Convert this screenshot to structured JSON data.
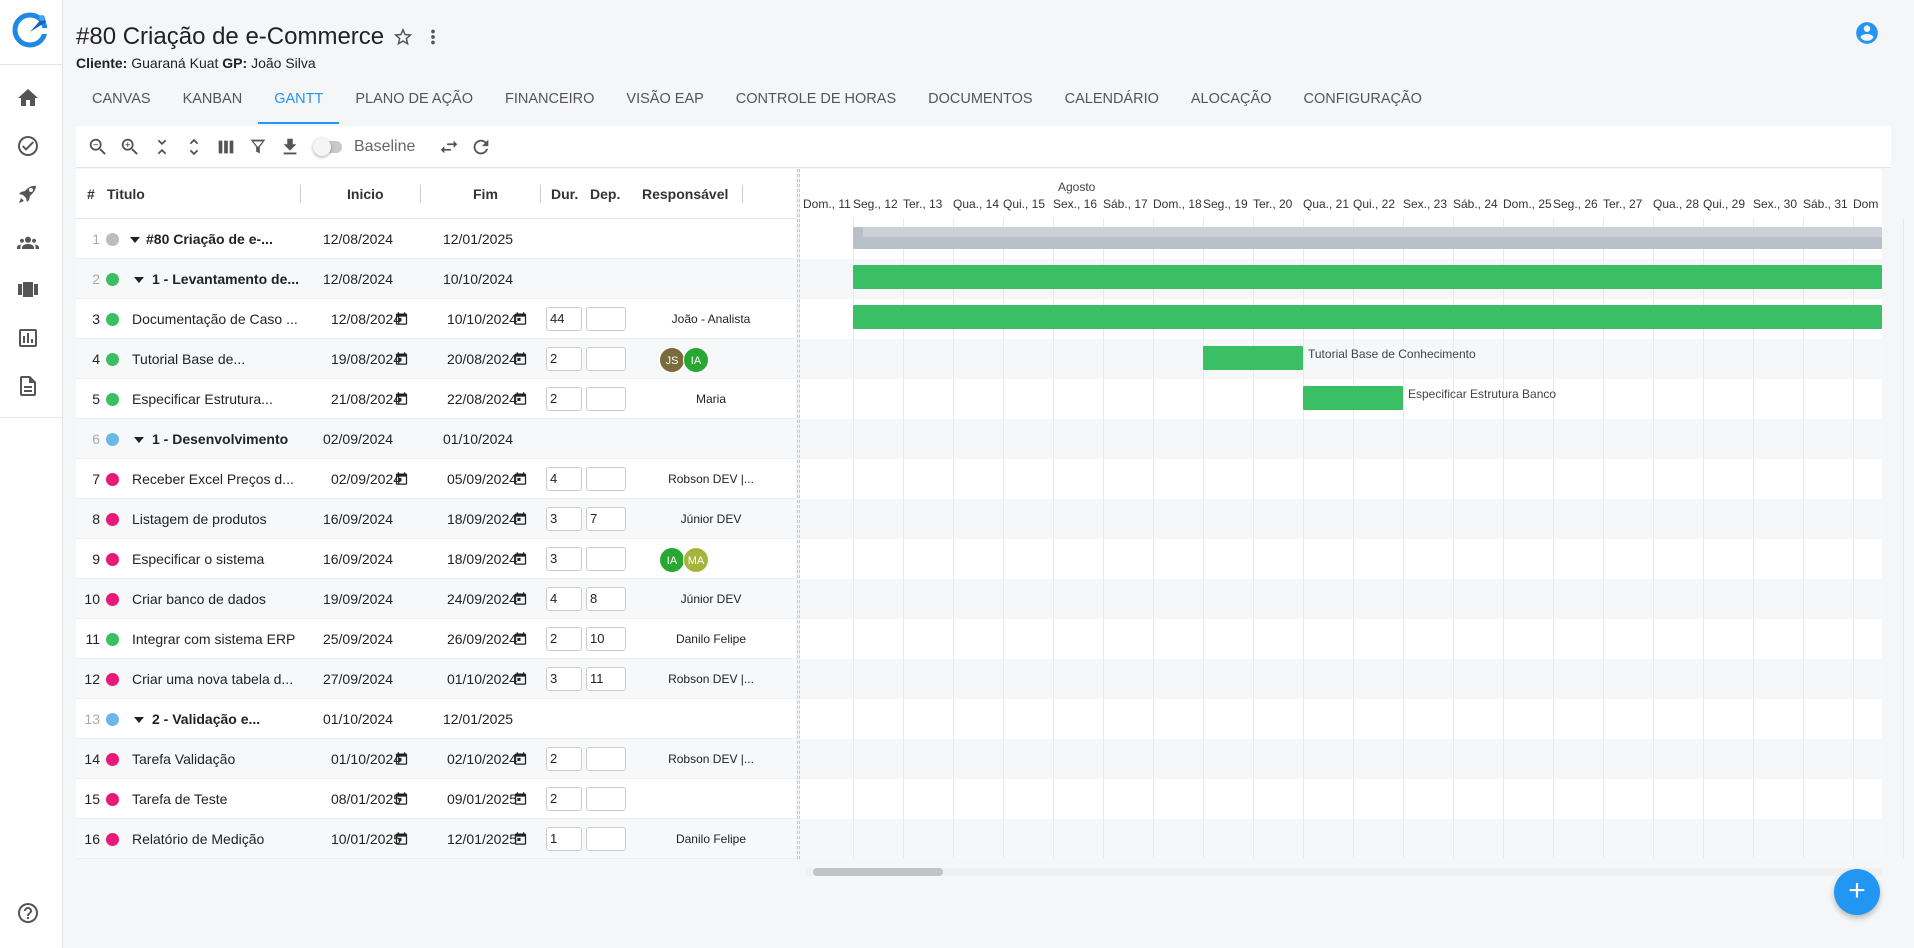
{
  "header": {
    "title": "#80 Criação de e-Commerce",
    "client_label": "Cliente:",
    "client_value": "Guaraná Kuat",
    "gp_label": "GP:",
    "gp_value": "João Silva"
  },
  "tabs": [
    "CANVAS",
    "KANBAN",
    "GANTT",
    "PLANO DE AÇÃO",
    "FINANCEIRO",
    "VISÃO EAP",
    "CONTROLE DE HORAS",
    "DOCUMENTOS",
    "CALENDÁRIO",
    "ALOCAÇÃO",
    "CONFIGURAÇÃO"
  ],
  "active_tab": "GANTT",
  "toolbar": {
    "baseline_label": "Baseline"
  },
  "columns": {
    "num": "#",
    "title": "Titulo",
    "start": "Inicio",
    "end": "Fim",
    "dur": "Dur.",
    "dep": "Dep.",
    "resp": "Responsável"
  },
  "status_colors": {
    "gray": "#b9bec4",
    "green": "#3bbf64",
    "blue": "#6cb6e8",
    "pink": "#e8197a"
  },
  "rows": [
    {
      "n": "1",
      "status": "gray",
      "title": "#80 Criação de e-...",
      "start": "12/08/2024",
      "end": "12/01/2025",
      "dur": "",
      "dep": "",
      "resp": "",
      "bold": true
    },
    {
      "n": "2",
      "status": "green",
      "title": "1 - Levantamento de...",
      "start": "12/08/2024",
      "end": "10/10/2024",
      "dur": "",
      "dep": "",
      "resp": "",
      "bold": true
    },
    {
      "n": "3",
      "status": "green",
      "title": "Documentação de Caso ...",
      "start": "12/08/2024",
      "end": "10/10/2024",
      "dur": "44",
      "dep": "",
      "resp": "João - Analista"
    },
    {
      "n": "4",
      "status": "green",
      "title": "Tutorial Base de...",
      "start": "19/08/2024",
      "end": "20/08/2024",
      "dur": "2",
      "dep": "",
      "resp": "",
      "avatars": [
        "JS",
        "IA"
      ]
    },
    {
      "n": "5",
      "status": "green",
      "title": "Especificar Estrutura...",
      "start": "21/08/2024",
      "end": "22/08/2024",
      "dur": "2",
      "dep": "",
      "resp": "Maria"
    },
    {
      "n": "6",
      "status": "blue",
      "title": "1 - Desenvolvimento",
      "start": "02/09/2024",
      "end": "01/10/2024",
      "dur": "",
      "dep": "",
      "resp": "",
      "bold": true
    },
    {
      "n": "7",
      "status": "pink",
      "title": "Receber Excel Preços d...",
      "start": "02/09/2024",
      "end": "05/09/2024",
      "dur": "4",
      "dep": "",
      "resp": "Robson DEV |..."
    },
    {
      "n": "8",
      "status": "pink",
      "title": "Listagem de produtos",
      "start": "16/09/2024",
      "end": "18/09/2024",
      "dur": "3",
      "dep": "7",
      "resp": "Júnior DEV"
    },
    {
      "n": "9",
      "status": "pink",
      "title": "Especificar o sistema",
      "start": "16/09/2024",
      "end": "18/09/2024",
      "dur": "3",
      "dep": "",
      "resp": "",
      "avatars": [
        "IA",
        "MA"
      ]
    },
    {
      "n": "10",
      "status": "pink",
      "title": "Criar banco de dados",
      "start": "19/09/2024",
      "end": "24/09/2024",
      "dur": "4",
      "dep": "8",
      "resp": "Júnior DEV"
    },
    {
      "n": "11",
      "status": "green",
      "title": "Integrar com sistema ERP",
      "start": "25/09/2024",
      "end": "26/09/2024",
      "dur": "2",
      "dep": "10",
      "resp": "Danilo Felipe"
    },
    {
      "n": "12",
      "status": "pink",
      "title": "Criar uma nova tabela d...",
      "start": "27/09/2024",
      "end": "01/10/2024",
      "dur": "3",
      "dep": "11",
      "resp": "Robson DEV |..."
    },
    {
      "n": "13",
      "status": "blue",
      "title": "2 - Validação e...",
      "start": "01/10/2024",
      "end": "12/01/2025",
      "dur": "",
      "dep": "",
      "resp": "",
      "bold": true
    },
    {
      "n": "14",
      "status": "pink",
      "title": "Tarefa Validação",
      "start": "01/10/2024",
      "end": "02/10/2024",
      "dur": "2",
      "dep": "",
      "resp": "Robson DEV |..."
    },
    {
      "n": "15",
      "status": "pink",
      "title": "Tarefa de Teste",
      "start": "08/01/2025",
      "end": "09/01/2025",
      "dur": "2",
      "dep": "",
      "resp": ""
    },
    {
      "n": "16",
      "status": "pink",
      "title": "Relatório de Medição",
      "start": "10/01/2025",
      "end": "12/01/2025",
      "dur": "1",
      "dep": "",
      "resp": "Danilo Felipe"
    }
  ],
  "gantt": {
    "month": "Agosto",
    "days": [
      "Dom., 11",
      "Seg., 12",
      "Ter., 13",
      "Qua., 14",
      "Qui., 15",
      "Sex., 16",
      "Sáb., 17",
      "Dom., 18",
      "Seg., 19",
      "Ter., 20",
      "Qua., 21",
      "Qui., 22",
      "Sex., 23",
      "Sáb., 24",
      "Dom., 25",
      "Seg., 26",
      "Ter., 27",
      "Qua., 28",
      "Qui., 29",
      "Sex., 30",
      "Sáb., 31",
      "Dom"
    ],
    "bar_labels": {
      "row4": "Tutorial Base de Conhecimento",
      "row5": "Especificar Estrutura Banco"
    }
  },
  "fab_label": "+"
}
